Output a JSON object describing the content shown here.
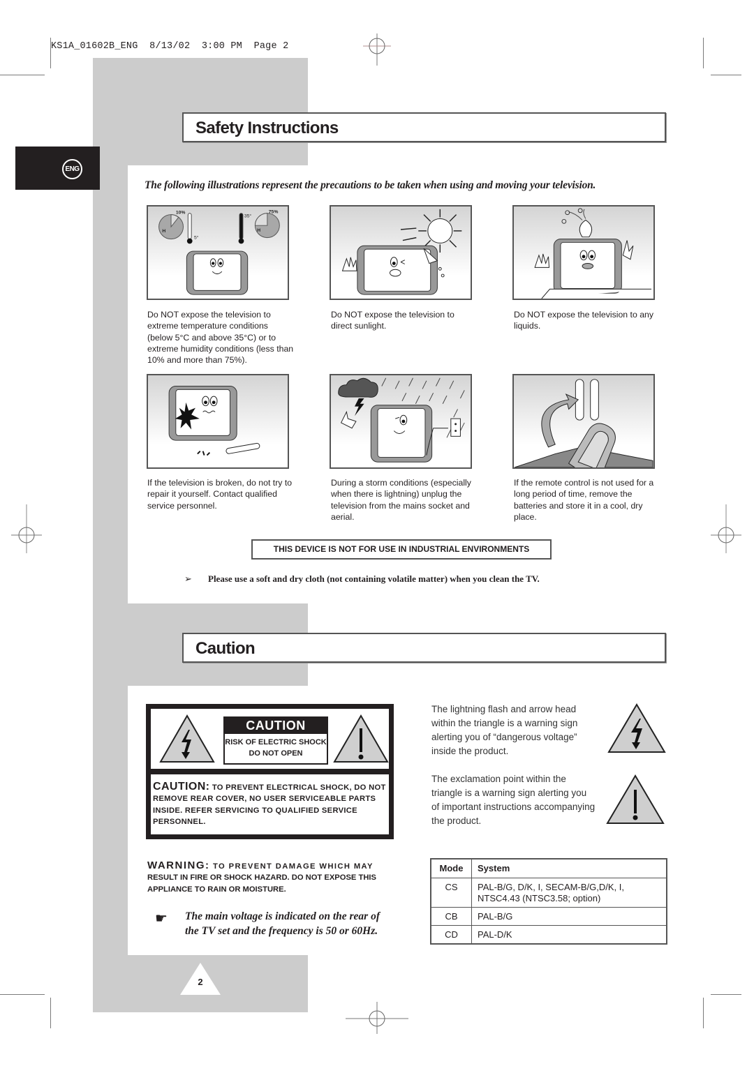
{
  "slug": {
    "file": "KS1A_01602B_ENG",
    "date": "8/13/02",
    "time": "3:00 PM",
    "page_label": "Page 2"
  },
  "language_tab": "ENG",
  "safety": {
    "title": "Safety Instructions",
    "intro": "The following illustrations represent the precautions to be taken when using and moving your television.",
    "illustrations": [
      {
        "icon": "temperature-humidity-illustration",
        "labels": {
          "humidity_low": "10%",
          "humidity_high": "75%",
          "temp_low": "5°",
          "temp_high": "35°",
          "humidity_letter": "H"
        },
        "caption": "Do NOT expose the television to extreme temperature conditions (below 5°C and above 35°C) or to extreme humidity conditions (less than 10% and more than 75%)."
      },
      {
        "icon": "sunlight-illustration",
        "caption": "Do NOT expose the television to direct sunlight."
      },
      {
        "icon": "liquids-illustration",
        "caption": "Do NOT expose the television to any liquids."
      },
      {
        "icon": "broken-tv-illustration",
        "caption": "If the television is broken, do not try to repair it yourself. Contact qualified service personnel."
      },
      {
        "icon": "storm-illustration",
        "caption": "During a storm conditions (especially when there is lightning) unplug the television from the mains socket and aerial."
      },
      {
        "icon": "remote-batteries-illustration",
        "caption": "If the remote control is not used for a long period of time, remove the batteries and store it in a cool, dry place."
      }
    ],
    "industrial_notice": "THIS DEVICE IS NOT FOR USE IN INDUSTRIAL ENVIRONMENTS",
    "cleaning_note_bullet": "➢",
    "cleaning_note": "Please use a soft and dry cloth (not containing volatile matter) when you clean the TV."
  },
  "caution": {
    "title": "Caution",
    "label": {
      "header": "CAUTION",
      "sub_line1": "RISK OF ELECTRIC SHOCK",
      "sub_line2": "DO NOT OPEN",
      "body_lead": "CAUTION:",
      "body_text": " TO PREVENT ELECTRICAL SHOCK, DO NOT REMOVE REAR COVER, NO USER SERVICEABLE PARTS INSIDE. REFER SERVICING TO QUALIFIED SERVICE PERSONNEL."
    },
    "warning_lead": "WARNING:",
    "warning_spaced": " TO PREVENT DAMAGE WHICH MAY",
    "warning_text": "RESULT IN FIRE OR SHOCK HAZARD. DO NOT EXPOSE THIS APPLIANCE TO RAIN OR MOISTURE.",
    "voltage_note": "The main voltage is indicated on the rear of the TV set and the frequency is 50 or 60Hz.",
    "voltage_bullet": "☛",
    "symbols": [
      {
        "icon": "lightning-warning-icon",
        "text": "The lightning flash and arrow head within the triangle is a warning sign alerting you of “dangerous voltage” inside the product."
      },
      {
        "icon": "exclamation-warning-icon",
        "text": "The exclamation point within the triangle is a warning sign alerting you of important instructions accompanying the product."
      }
    ],
    "mode_table": {
      "headers": [
        "Mode",
        "System"
      ],
      "rows": [
        {
          "mode": "CS",
          "system_line1": "PAL-B/G, D/K, I, SECAM-B/G,D/K, I,",
          "system_line2": "NTSC4.43 (NTSC3.58; option)"
        },
        {
          "mode": "CB",
          "system_line1": "PAL-B/G",
          "system_line2": ""
        },
        {
          "mode": "CD",
          "system_line1": "PAL-D/K",
          "system_line2": ""
        }
      ]
    }
  },
  "page_number": "2",
  "colors": {
    "grey_band": "#cccccc",
    "ink": "#231f20",
    "border": "#555555"
  }
}
